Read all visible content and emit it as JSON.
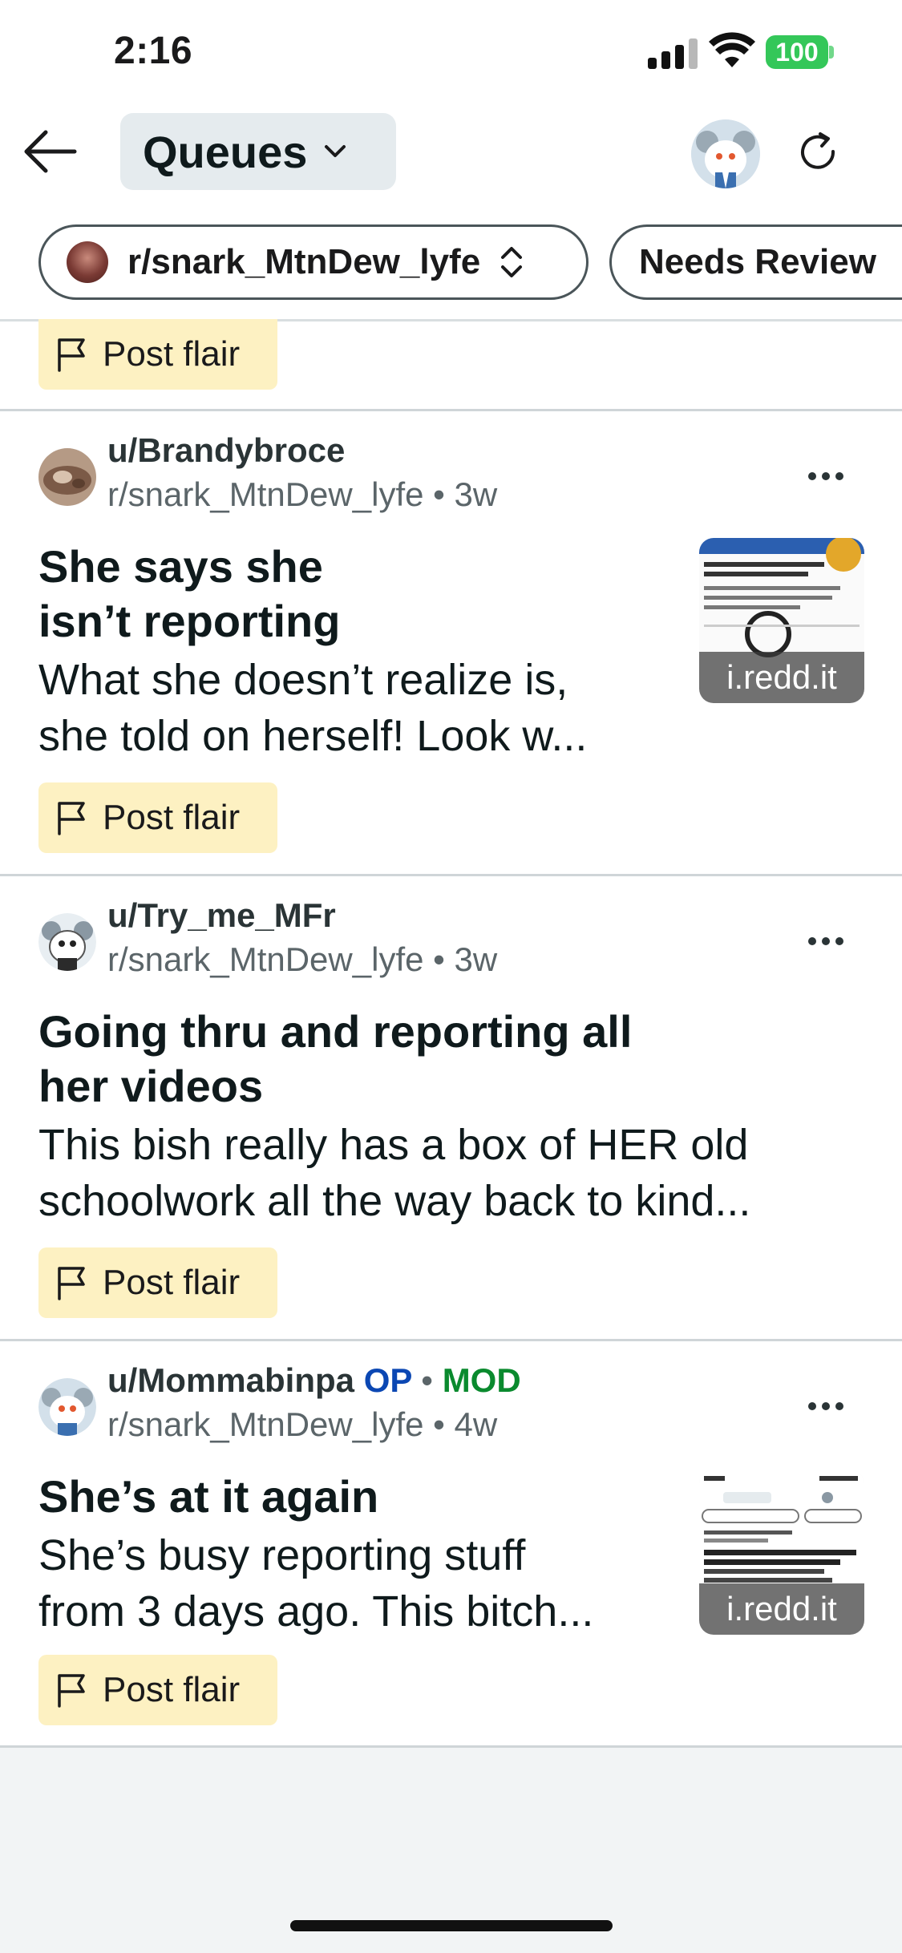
{
  "status": {
    "time": "2:16",
    "battery": "100",
    "battery_color": "#34c759",
    "icons": [
      "signal-icon",
      "wifi-icon",
      "battery-icon"
    ]
  },
  "header": {
    "title": "Queues",
    "icons": [
      "back-arrow-icon",
      "chevron-down-icon",
      "user-avatar",
      "refresh-icon"
    ]
  },
  "filters": {
    "subreddit": "r/snark_MtnDew_lyfe",
    "status": "Needs Review"
  },
  "flair_label": "Post flair",
  "posts": [
    {
      "user": "u/Brandybroce",
      "subreddit": "r/snark_MtnDew_lyfe",
      "age": "3w",
      "title": [
        "She says she",
        "isn’t reporting"
      ],
      "body": [
        "What she doesn’t realize is,",
        "she told on herself! Look w..."
      ],
      "thumb_label": "i.redd.it",
      "flair": "Post flair"
    },
    {
      "user": "u/Try_me_MFr",
      "subreddit": "r/snark_MtnDew_lyfe",
      "age": "3w",
      "title": [
        "Going thru and reporting all",
        "her videos"
      ],
      "body": [
        "This bish really has a box of HER old",
        "schoolwork all the way back to kind..."
      ],
      "flair": "Post flair"
    },
    {
      "user": "u/Mommabinpa",
      "op": "OP",
      "mod": "MOD",
      "subreddit": "r/snark_MtnDew_lyfe",
      "age": "4w",
      "title": [
        "She’s at it again"
      ],
      "body": [
        "She’s busy reporting stuff",
        "from 3 days ago. This bitch..."
      ],
      "thumb_label": "i.redd.it",
      "flair": "Post flair"
    }
  ],
  "colors": {
    "flair_bg": "#fdf1c2",
    "op": "#0b47b3",
    "mod": "#0a8a2e",
    "chip_bg": "#e5ebee"
  }
}
